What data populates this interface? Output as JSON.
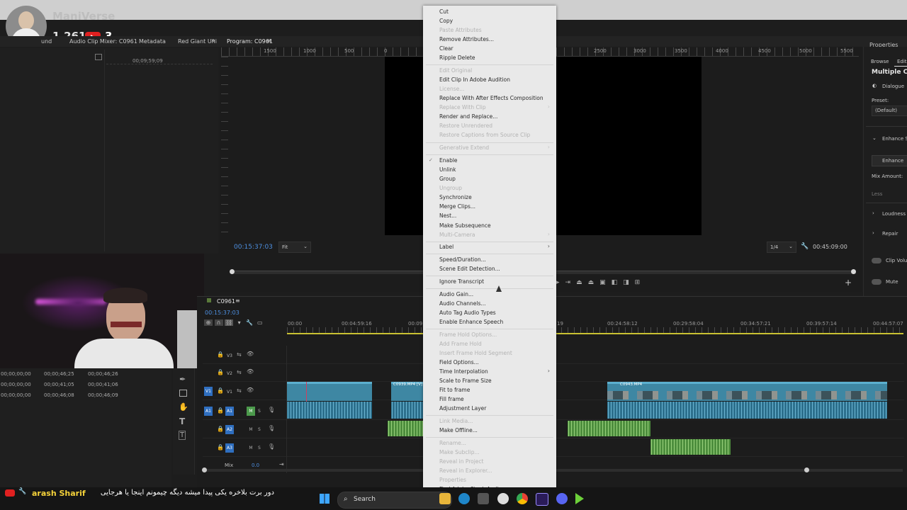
{
  "overlay": {
    "channel_name": "ManiVerse",
    "viewer_count": "1,261",
    "live_count": "3"
  },
  "panels": {
    "source_tabs": [
      "und",
      "Audio Clip Mixer: C0961",
      "Metadata",
      "Red Giant Uni"
    ],
    "overflow": "»",
    "program_title": "Program: C0961",
    "properties_title": "Properties",
    "timeline_title": "C0961",
    "source_timecode": "00;09;59;09"
  },
  "program": {
    "ruler_ticks": [
      "1500",
      "1000",
      "500",
      "0",
      "2500",
      "3000",
      "3500",
      "4000",
      "4500",
      "5000",
      "5500"
    ],
    "left_timecode": "00:15:37:03",
    "fit_option": "Fit",
    "resolution_option": "1/4",
    "right_timecode": "00:45:09:00"
  },
  "properties": {
    "tabs": [
      "Browse",
      "Edit"
    ],
    "heading": "Multiple Clips",
    "dialogue": "Dialogue",
    "preset_label": "Preset:",
    "preset_value": "(Default)",
    "enhance_section": "Enhance Sp",
    "enhance_button": "Enhance",
    "mix_amount": "Mix Amount:",
    "less": "Less",
    "loudness": "Loudness",
    "repair": "Repair",
    "clip_volume": "Clip Volu",
    "mute": "Mute"
  },
  "timeline": {
    "current_timecode": "00:15:37:03",
    "ruler": [
      "00:00",
      "00:04:59:16",
      "00:09",
      "19",
      "00:24:58:12",
      "00:29:58:04",
      "00:34:57:21",
      "00:39:57:14",
      "00:44:57:07"
    ],
    "tracks": [
      {
        "id": "V3"
      },
      {
        "id": "V2"
      },
      {
        "id": "V1",
        "target": "V1"
      },
      {
        "id": "A1",
        "target": "A1"
      },
      {
        "id": "A2"
      },
      {
        "id": "A3"
      }
    ],
    "mix_label": "Mix",
    "mix_value": "0.0",
    "clip_label_1": "C0939.MP4 [V]",
    "clip_label_2": "C0943.MP4"
  },
  "left_list": [
    [
      "00;00;00;00",
      "00;00;46;25",
      "00;00;46;26"
    ],
    [
      "00;00;00;00",
      "00;00;41;05",
      "00;00;41;06"
    ],
    [
      "00;00;00;00",
      "00;00;46;08",
      "00;00;46;09"
    ]
  ],
  "context_menu": [
    {
      "label": "Cut",
      "enabled": true
    },
    {
      "label": "Copy",
      "enabled": true
    },
    {
      "label": "Paste Attributes",
      "enabled": false
    },
    {
      "label": "Remove Attributes...",
      "enabled": true
    },
    {
      "label": "Clear",
      "enabled": true
    },
    {
      "label": "Ripple Delete",
      "enabled": true
    },
    {
      "sep": true
    },
    {
      "label": "Edit Original",
      "enabled": false
    },
    {
      "label": "Edit Clip In Adobe Audition",
      "enabled": true
    },
    {
      "label": "License...",
      "enabled": false
    },
    {
      "label": "Replace With After Effects Composition",
      "enabled": true
    },
    {
      "label": "Replace With Clip",
      "enabled": false,
      "submenu": true
    },
    {
      "label": "Render and Replace...",
      "enabled": true
    },
    {
      "label": "Restore Unrendered",
      "enabled": false
    },
    {
      "label": "Restore Captions from Source Clip",
      "enabled": false
    },
    {
      "sep": true
    },
    {
      "label": "Generative Extend",
      "enabled": false,
      "submenu": true
    },
    {
      "sep": true
    },
    {
      "label": "Enable",
      "enabled": true,
      "checked": true
    },
    {
      "label": "Unlink",
      "enabled": true
    },
    {
      "label": "Group",
      "enabled": true
    },
    {
      "label": "Ungroup",
      "enabled": false
    },
    {
      "label": "Synchronize",
      "enabled": true
    },
    {
      "label": "Merge Clips...",
      "enabled": true
    },
    {
      "label": "Nest...",
      "enabled": true
    },
    {
      "label": "Make Subsequence",
      "enabled": true
    },
    {
      "label": "Multi-Camera",
      "enabled": false,
      "submenu": true
    },
    {
      "sep": true
    },
    {
      "label": "Label",
      "enabled": true,
      "submenu": true
    },
    {
      "sep": true
    },
    {
      "label": "Speed/Duration...",
      "enabled": true
    },
    {
      "label": "Scene Edit Detection...",
      "enabled": true
    },
    {
      "sep": true
    },
    {
      "label": "Ignore Transcript",
      "enabled": true
    },
    {
      "sep": true
    },
    {
      "label": "Audio Gain...",
      "enabled": true
    },
    {
      "label": "Audio Channels...",
      "enabled": true
    },
    {
      "label": "Auto Tag Audio Types",
      "enabled": true
    },
    {
      "label": "Enable Enhance Speech",
      "enabled": true
    },
    {
      "sep": true
    },
    {
      "label": "Frame Hold Options...",
      "enabled": false
    },
    {
      "label": "Add Frame Hold",
      "enabled": false
    },
    {
      "label": "Insert Frame Hold Segment",
      "enabled": false
    },
    {
      "label": "Field Options...",
      "enabled": true
    },
    {
      "label": "Time Interpolation",
      "enabled": true,
      "submenu": true
    },
    {
      "label": "Scale to Frame Size",
      "enabled": true
    },
    {
      "label": "Fit to frame",
      "enabled": true
    },
    {
      "label": "Fill frame",
      "enabled": true
    },
    {
      "label": "Adjustment Layer",
      "enabled": true
    },
    {
      "sep": true
    },
    {
      "label": "Link Media...",
      "enabled": false
    },
    {
      "label": "Make Offline...",
      "enabled": true
    },
    {
      "sep": true
    },
    {
      "label": "Rename...",
      "enabled": false
    },
    {
      "label": "Make Subclip...",
      "enabled": false
    },
    {
      "label": "Reveal in Project",
      "enabled": false
    },
    {
      "label": "Reveal in Explorer...",
      "enabled": false
    },
    {
      "label": "Properties",
      "enabled": false
    },
    {
      "label": "Find Adobe Stock Audio",
      "enabled": true
    }
  ],
  "chat": {
    "user": "arash Sharif",
    "message": "دور برت بلاخره یکی پیدا میشه دیگه چیمونم اینجا یا هرجایی"
  },
  "taskbar": {
    "search_placeholder": "Search"
  },
  "colors": {
    "accent_blue": "#4d8fe0",
    "clip_video": "#3e87a3",
    "clip_audio_green": "#4d8e3d",
    "menu_bg": "#e9e9e9"
  }
}
